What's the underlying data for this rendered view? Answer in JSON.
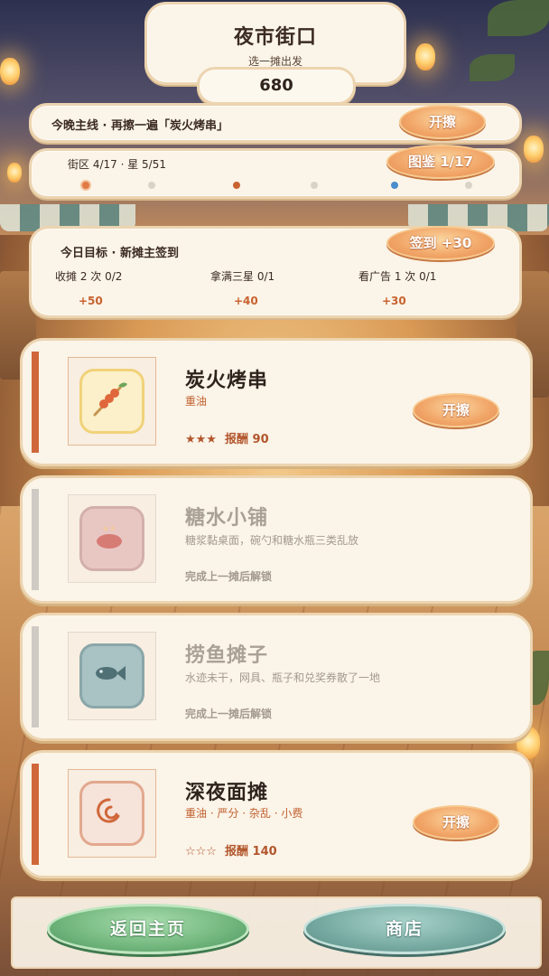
{
  "header": {
    "title": "夜市街口",
    "subtitle": "选一摊出发",
    "score": "680"
  },
  "quest": {
    "text": "今晚主线 · 再擦一遍「炭火烤串」",
    "button": "开擦"
  },
  "map": {
    "progress": "街区 4/17 · 星 5/51",
    "collection_button": "图鉴 1/17",
    "dots": [
      "#e07a45",
      "#d9d2c6",
      "#c9642f",
      "#d9d2c6",
      "#4a8ccc",
      "#d9d2c6"
    ]
  },
  "daily": {
    "title": "今日目标 · 新摊主签到",
    "checkin_button": "签到 +30",
    "goals": [
      {
        "label": "收摊 2 次  0/2",
        "reward": "+50"
      },
      {
        "label": "拿满三星  0/1",
        "reward": "+40"
      },
      {
        "label": "看广告 1 次  0/1",
        "reward": "+30"
      }
    ]
  },
  "stalls": [
    {
      "name": "炭火烤串",
      "tags": "重油",
      "stars": "★★★",
      "reward": "报酬 90",
      "button": "开擦",
      "locked": false,
      "icon": "skewer-icon"
    },
    {
      "name": "糖水小铺",
      "desc": "糖浆黏桌面，碗勺和糖水瓶三类乱放",
      "lock_text": "完成上一摊后解锁",
      "locked": true,
      "icon": "dessert-bowl-icon"
    },
    {
      "name": "捞鱼摊子",
      "desc": "水迹未干，网具、瓶子和兑奖券散了一地",
      "lock_text": "完成上一摊后解锁",
      "locked": true,
      "icon": "fish-icon"
    },
    {
      "name": "深夜面摊",
      "tags": "重油 · 严分 · 杂乱 · 小费",
      "stars": "☆☆☆",
      "reward": "报酬 140",
      "button": "开擦",
      "locked": false,
      "icon": "noodle-icon"
    }
  ],
  "nav": {
    "home": "返回主页",
    "shop": "商店"
  },
  "colors": {
    "accent_orange": "#e58b4f",
    "stripe_active": "#d0673a",
    "stripe_locked": "#cfcac4",
    "panel": "#fbf4e8"
  }
}
